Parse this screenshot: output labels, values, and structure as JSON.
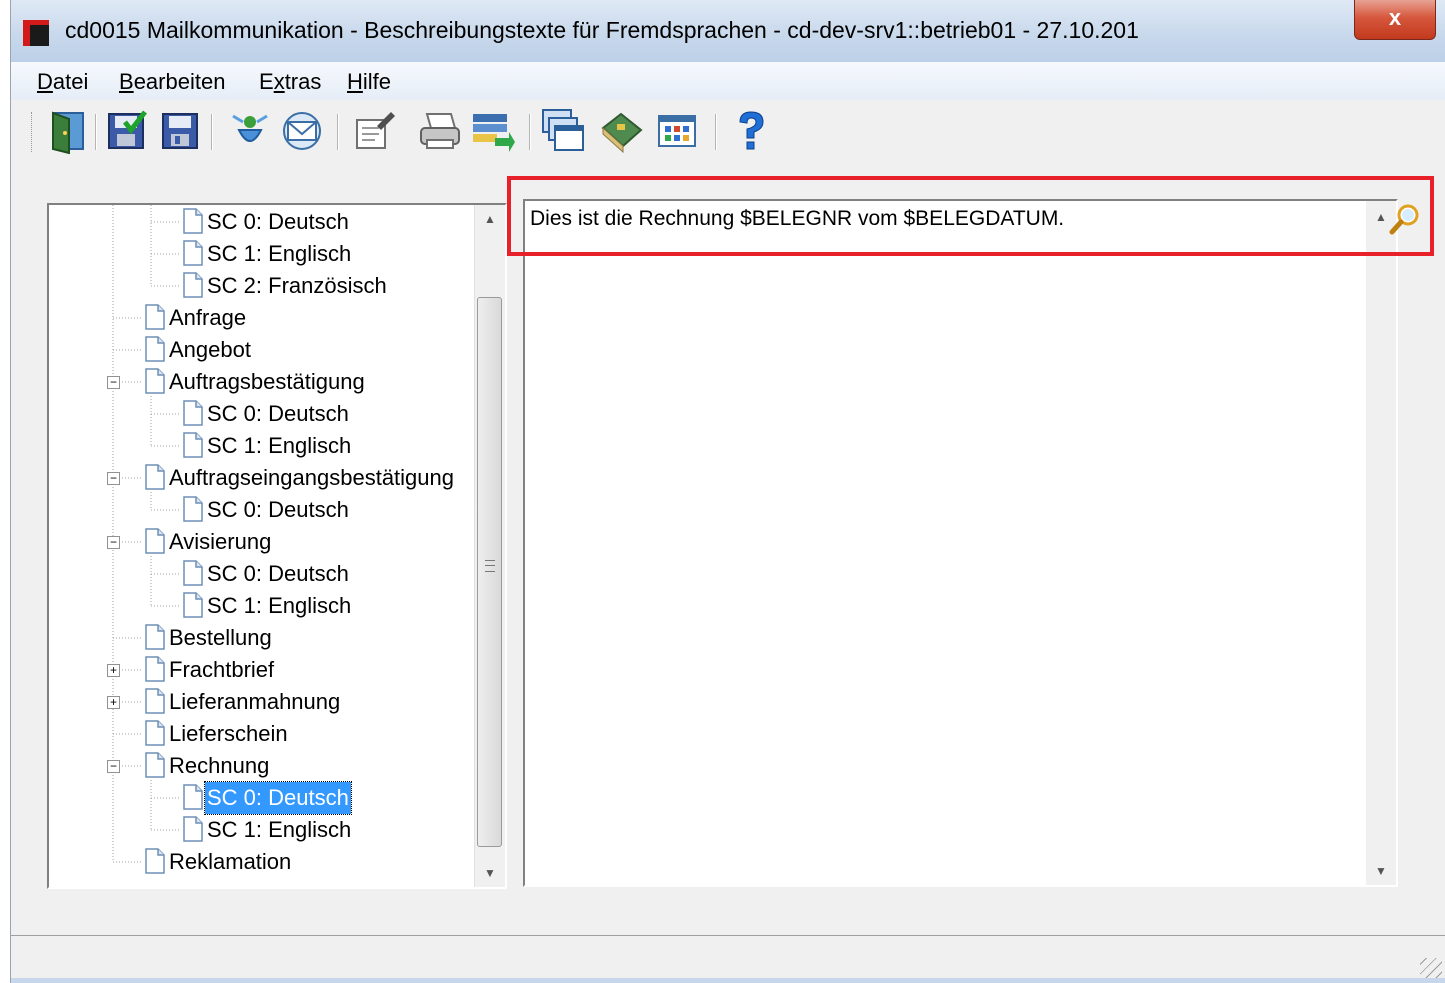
{
  "window": {
    "title": "cd0015 Mailkommunikation - Beschreibungstexte für Fremdsprachen - cd-dev-srv1::betrieb01 - 27.10.201",
    "close_label": "x"
  },
  "menu": [
    {
      "pre": "",
      "acc": "D",
      "post": "atei"
    },
    {
      "pre": "",
      "acc": "B",
      "post": "earbeiten"
    },
    {
      "pre": "E",
      "acc": "x",
      "post": "tras"
    },
    {
      "pre": "",
      "acc": "H",
      "post": "ilfe"
    }
  ],
  "toolbar": {
    "icons": [
      "exit-door-icon",
      "save-check-icon",
      "save-icon",
      "mail-receive-icon",
      "mail-envelope-icon",
      "properties-icon",
      "printer-icon",
      "import-export-icon",
      "windows-icon",
      "book-icon",
      "calendar-grid-icon",
      "help-icon"
    ]
  },
  "tree": {
    "items": [
      {
        "label": "SC 0: Deutsch",
        "level": 2
      },
      {
        "label": "SC 1: Englisch",
        "level": 2
      },
      {
        "label": "SC 2: Französisch",
        "level": 2
      },
      {
        "label": "Anfrage",
        "level": 1
      },
      {
        "label": "Angebot",
        "level": 1
      },
      {
        "label": "Auftragsbestätigung",
        "level": 1,
        "expander": "minus"
      },
      {
        "label": "SC 0: Deutsch",
        "level": 2
      },
      {
        "label": "SC 1: Englisch",
        "level": 2
      },
      {
        "label": "Auftragseingangsbestätigung",
        "level": 1,
        "expander": "minus"
      },
      {
        "label": "SC 0: Deutsch",
        "level": 2
      },
      {
        "label": "Avisierung",
        "level": 1,
        "expander": "minus"
      },
      {
        "label": "SC 0: Deutsch",
        "level": 2
      },
      {
        "label": "SC 1: Englisch",
        "level": 2
      },
      {
        "label": "Bestellung",
        "level": 1
      },
      {
        "label": "Frachtbrief",
        "level": 1,
        "expander": "plus"
      },
      {
        "label": "Lieferanmahnung",
        "level": 1,
        "expander": "plus"
      },
      {
        "label": "Lieferschein",
        "level": 1
      },
      {
        "label": "Rechnung",
        "level": 1,
        "expander": "minus"
      },
      {
        "label": "SC 0: Deutsch",
        "level": 2,
        "selected": true
      },
      {
        "label": "SC 1: Englisch",
        "level": 2
      },
      {
        "label": "Reklamation",
        "level": 1
      }
    ]
  },
  "editor": {
    "text": "Dies ist die Rechnung $BELEGNR vom $BELEGDATUM."
  },
  "colors": {
    "selection": "#3399ff",
    "highlight_border": "#e8202a"
  }
}
